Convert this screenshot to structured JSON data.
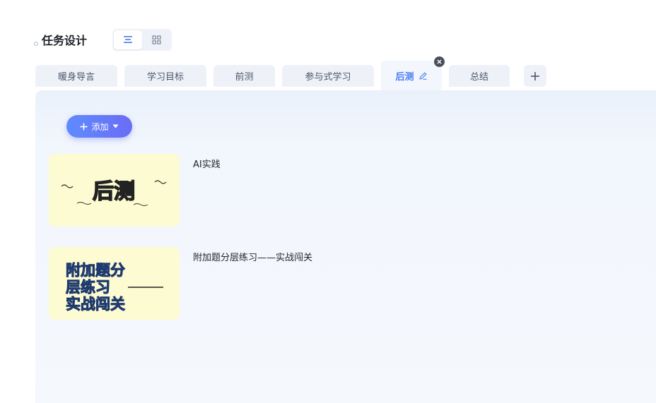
{
  "header": {
    "title": "任务设计"
  },
  "view_toggle": {
    "list_icon": "list-view-icon",
    "grid_icon": "grid-view-icon",
    "active": "list"
  },
  "tabs": [
    {
      "label": "暖身导言"
    },
    {
      "label": "学习目标"
    },
    {
      "label": "前测"
    },
    {
      "label": "参与式学习"
    },
    {
      "label": "后测",
      "active": true
    },
    {
      "label": "总结"
    }
  ],
  "add_button": {
    "label": "添加"
  },
  "items": [
    {
      "title": "AI实践",
      "thumb_text": "后测"
    },
    {
      "title": "附加题分层练习——实战闯关",
      "thumb_lines": [
        "附加题分",
        "层练习",
        "实战闯关"
      ]
    }
  ],
  "colors": {
    "accent": "#4a7df0",
    "button_gradient_start": "#5f8bff",
    "button_gradient_end": "#6b6df4",
    "tab_bg": "#eef2f8",
    "thumb_bg": "#fdfbd2"
  }
}
